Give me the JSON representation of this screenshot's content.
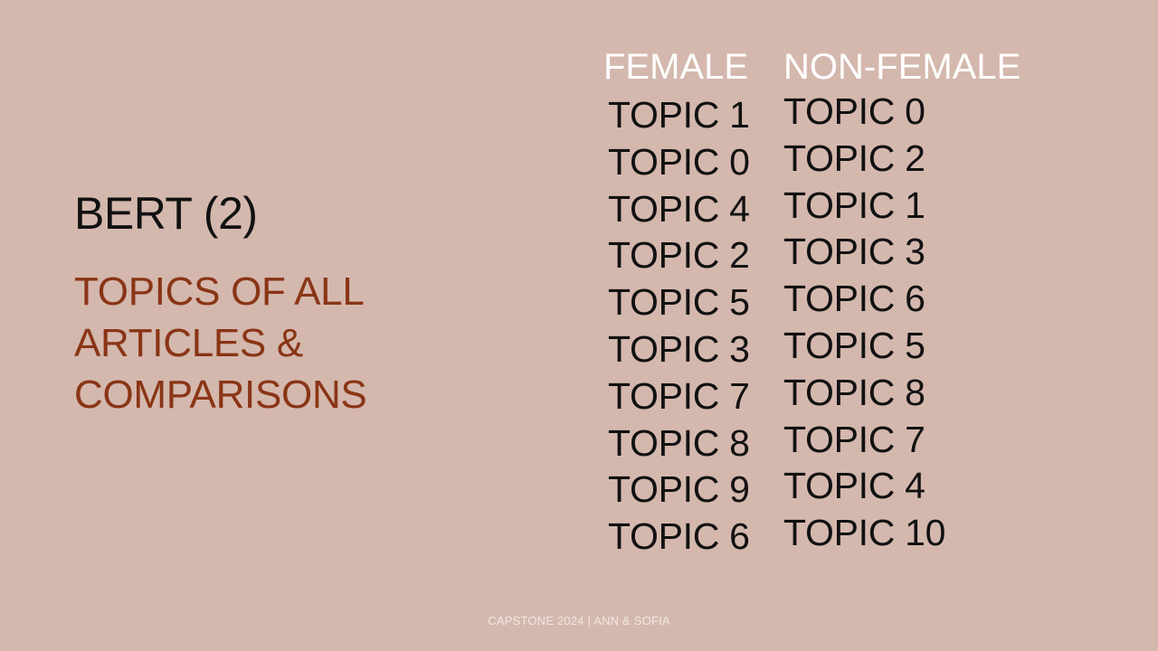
{
  "slide": {
    "title": "BERT (2)",
    "subtitle_lines": [
      "TOPICS OF ALL",
      "ARTICLES &",
      "COMPARISONS"
    ],
    "columns": [
      {
        "header": "FEMALE",
        "items": [
          "TOPIC 1",
          "TOPIC 0",
          "TOPIC 4",
          "TOPIC 2",
          "TOPIC 5",
          "TOPIC 3",
          "TOPIC 7",
          "TOPIC 8",
          "TOPIC 9",
          "TOPIC 6"
        ]
      },
      {
        "header": "NON-FEMALE",
        "items": [
          "TOPIC 0",
          "TOPIC 2",
          "TOPIC 1",
          "TOPIC 3",
          "TOPIC 6",
          "TOPIC 5",
          "TOPIC 8",
          "TOPIC 7",
          "TOPIC 4",
          "TOPIC 10"
        ]
      }
    ],
    "footer": "CAPSTONE 2024 | ANN & SOFIA"
  },
  "colors": {
    "background": "#d4b8ae",
    "title": "#111111",
    "subtitle": "#8a3516",
    "column_header": "#ffffff",
    "footer": "#f3e7e2"
  }
}
